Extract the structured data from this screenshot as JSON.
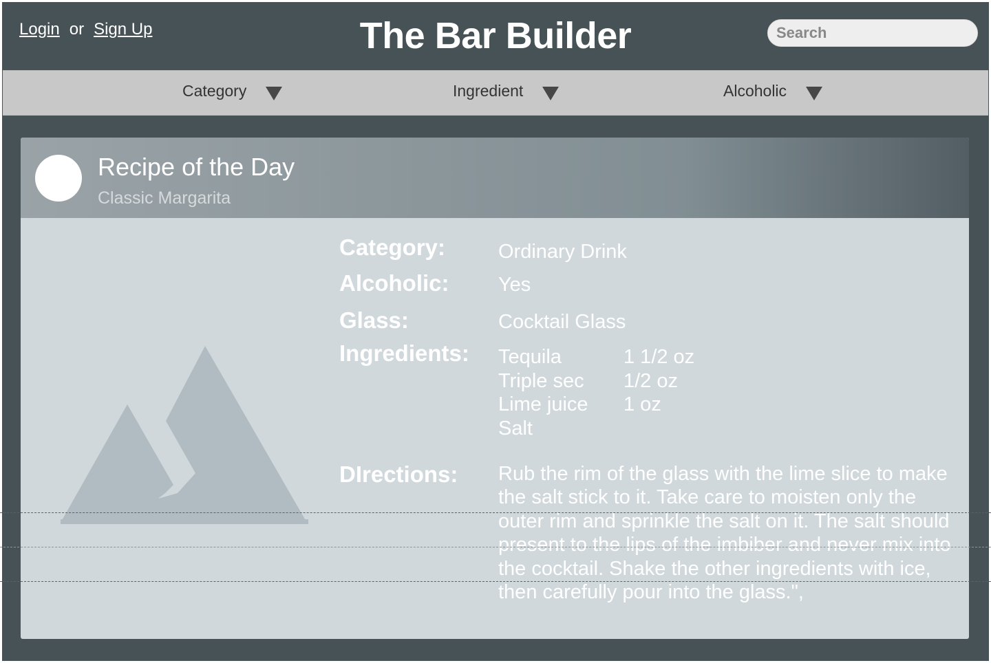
{
  "header": {
    "login": "Login",
    "or": "or",
    "signup": "Sign Up",
    "title": "The Bar Builder",
    "search_placeholder": "Search"
  },
  "filters": [
    {
      "label": "Category"
    },
    {
      "label": "Ingredient"
    },
    {
      "label": "Alcoholic"
    }
  ],
  "recipe": {
    "heading": "Recipe of the Day",
    "name": "Classic Margarita",
    "category_label": "Category:",
    "category": "Ordinary Drink",
    "alcoholic_label": "Alcoholic:",
    "alcoholic": "Yes",
    "glass_label": "Glass:",
    "glass": "Cocktail Glass",
    "ingredients_label": "Ingredients:",
    "ingredients": [
      {
        "name": "Tequila",
        "amount": "1 1/2 oz"
      },
      {
        "name": "Triple sec",
        "amount": "1/2 oz"
      },
      {
        "name": "Lime juice",
        "amount": "1 oz"
      },
      {
        "name": "Salt",
        "amount": ""
      }
    ],
    "directions_label": "DIrections:",
    "directions": "Rub the rim of the glass with the lime slice to make the salt stick to it. Take care to moisten only the outer rim and sprinkle the salt on it. The salt should present to the lips of the imbiber and never mix into the cocktail. Shake the other ingredients with ice, then carefully pour into the glass.\","
  },
  "colors": {
    "background": "#475257",
    "filter_bar": "#c8c8c8",
    "card": "#d0d8db",
    "placeholder_image": "#b0bcc2"
  }
}
